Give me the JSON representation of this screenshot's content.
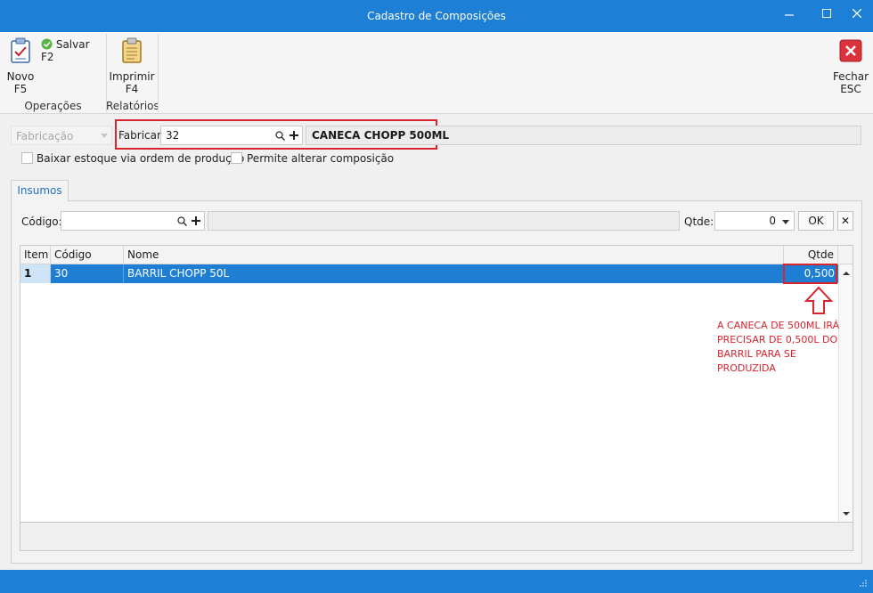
{
  "window": {
    "title": "Cadastro de Composições",
    "controls": [
      "minimize",
      "maximize",
      "close"
    ]
  },
  "ribbon": {
    "novo": {
      "line1": "Novo",
      "line2": "F5"
    },
    "salvar": "Salvar F2",
    "imprimir": {
      "line1": "Imprimir",
      "line2": "F4"
    },
    "fechar": {
      "line1": "Fechar",
      "line2": "ESC"
    },
    "group_operacoes": "Operações",
    "group_relatorios": "Relatórios"
  },
  "fabricacao": {
    "type_combo": "Fabricação",
    "fabricar_label": "Fabricar:",
    "fabricar_value": "32",
    "product_name": "CANECA CHOPP 500ML",
    "chk_baixar": "Baixar estoque via ordem de produção",
    "chk_permite": "Permite alterar composição"
  },
  "tabs": [
    {
      "label": "Insumos"
    }
  ],
  "insumos": {
    "codigo_label": "Código:",
    "codigo_value": "",
    "qtde_label": "Qtde:",
    "qtde_value": "0",
    "ok_label": "OK",
    "remove_label": "✕"
  },
  "grid": {
    "columns": [
      "Item",
      "Código",
      "Nome",
      "Qtde"
    ],
    "rows": [
      {
        "item": "1",
        "codigo": "30",
        "nome": "BARRIL CHOPP 50L",
        "qtde": "0,500"
      }
    ]
  },
  "annotation": {
    "text": "A CANECA DE 500ML IRÁ PRECISAR DE 0,500L DO BARRIL PARA SE PRODUZIDA"
  },
  "colors": {
    "accent": "#1e7fd6",
    "highlight": "#d9232d"
  }
}
